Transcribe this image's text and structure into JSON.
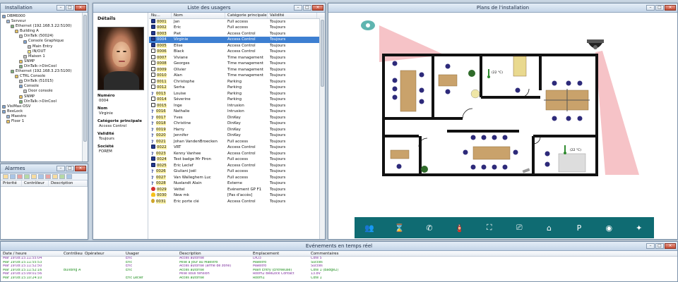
{
  "installation": {
    "title": "Installation",
    "tree": [
      {
        "label": "DBM6000",
        "depth": 0,
        "icon": "pc"
      },
      {
        "label": "Serveur",
        "depth": 1,
        "icon": "srv"
      },
      {
        "label": "Ethernet (192.168.3.22:5100)",
        "depth": 2,
        "icon": "net"
      },
      {
        "label": "Building A",
        "depth": 3,
        "icon": "fold"
      },
      {
        "label": "DinTalk (50024)",
        "depth": 4,
        "icon": "dev"
      },
      {
        "label": "Console Graphique",
        "depth": 5,
        "icon": "pc"
      },
      {
        "label": "Main Entry",
        "depth": 6,
        "icon": "dev"
      },
      {
        "label": "IN/OUT",
        "depth": 6,
        "icon": "key"
      },
      {
        "label": "Maison 1",
        "depth": 5,
        "icon": "dev"
      },
      {
        "label": "SNMP",
        "depth": 4,
        "icon": "fold"
      },
      {
        "label": "DinTalk->DinCool",
        "depth": 4,
        "icon": "net"
      },
      {
        "label": "Ethernet (192.168.3.23:5100)",
        "depth": 2,
        "icon": "net"
      },
      {
        "label": "CTRL Console",
        "depth": 3,
        "icon": "fold"
      },
      {
        "label": "DinTalk (51015)",
        "depth": 4,
        "icon": "dev"
      },
      {
        "label": "Console",
        "depth": 4,
        "icon": "pc"
      },
      {
        "label": "Door console",
        "depth": 5,
        "icon": "dev"
      },
      {
        "label": "SNMP",
        "depth": 4,
        "icon": "fold"
      },
      {
        "label": "DinTalk->DinCool",
        "depth": 4,
        "icon": "net"
      },
      {
        "label": "VisiMax-OSV",
        "depth": 0,
        "icon": "pc"
      },
      {
        "label": "BeeLock",
        "depth": 0,
        "icon": "pc"
      },
      {
        "label": "Maestro",
        "depth": 1,
        "icon": "srv"
      },
      {
        "label": "Floor 1",
        "depth": 1,
        "icon": "fold"
      }
    ]
  },
  "alarmes": {
    "title": "Alarmes",
    "columns": [
      "Priorité",
      "Contrôleur",
      "Description"
    ]
  },
  "users": {
    "title": "Liste des usagers",
    "details_title": "Détails",
    "details": [
      {
        "label": "Numéro",
        "value": "0004"
      },
      {
        "label": "Nom",
        "value": "Virginie"
      },
      {
        "label": "Catégorie principale",
        "value": "Access Control"
      },
      {
        "label": "Validité",
        "value": "Toujours"
      },
      {
        "label": "Société",
        "value": "FOREM"
      }
    ],
    "columns": [
      "Nu...",
      "Nom",
      "Catégorie principale",
      "Validité"
    ],
    "selected_index": 3,
    "rows": [
      {
        "icon": "badge",
        "num": "0001",
        "name": "Jan",
        "cat": "Full access",
        "val": "Toujours"
      },
      {
        "icon": "badge",
        "num": "0002",
        "name": "Eric",
        "cat": "Full access",
        "val": "Toujours"
      },
      {
        "icon": "badge",
        "num": "0003",
        "name": "Piet",
        "cat": "Access Control",
        "val": "Toujours"
      },
      {
        "icon": "badge",
        "num": "0004",
        "name": "Virginie",
        "cat": "Access Control",
        "val": "Toujours"
      },
      {
        "icon": "badge",
        "num": "0005",
        "name": "Elise",
        "cat": "Access Control",
        "val": "Toujours"
      },
      {
        "icon": "card",
        "num": "0006",
        "name": "Black",
        "cat": "Access Control",
        "val": "Toujours"
      },
      {
        "icon": "card",
        "num": "0007",
        "name": "Viviane",
        "cat": "Time management",
        "val": "Toujours"
      },
      {
        "icon": "card",
        "num": "0008",
        "name": "Georges",
        "cat": "Time management",
        "val": "Toujours"
      },
      {
        "icon": "card",
        "num": "0009",
        "name": "Olivier",
        "cat": "Time management",
        "val": "Toujours"
      },
      {
        "icon": "card",
        "num": "0010",
        "name": "Alan",
        "cat": "Time management",
        "val": "Toujours"
      },
      {
        "icon": "card",
        "num": "0011",
        "name": "Christophe",
        "cat": "Parking",
        "val": "Toujours"
      },
      {
        "icon": "card",
        "num": "0012",
        "name": "Serha",
        "cat": "Parking",
        "val": "Toujours"
      },
      {
        "icon": "q",
        "num": "0013",
        "name": "Louise",
        "cat": "Parking",
        "val": "Toujours"
      },
      {
        "icon": "card",
        "num": "0014",
        "name": "Séverine",
        "cat": "Parking",
        "val": "Toujours"
      },
      {
        "icon": "card",
        "num": "0015",
        "name": "Inge",
        "cat": "Intrusion",
        "val": "Toujours"
      },
      {
        "icon": "q",
        "num": "0016",
        "name": "Nathalie",
        "cat": "Intrusion",
        "val": "Toujours"
      },
      {
        "icon": "q",
        "num": "0017",
        "name": "Yves",
        "cat": "DinKey",
        "val": "Toujours"
      },
      {
        "icon": "q",
        "num": "0018",
        "name": "Christine",
        "cat": "DinKey",
        "val": "Toujours"
      },
      {
        "icon": "q",
        "num": "0019",
        "name": "Harry",
        "cat": "DinKey",
        "val": "Toujours"
      },
      {
        "icon": "q",
        "num": "0020",
        "name": "Jennifer",
        "cat": "DinKey",
        "val": "Toujours"
      },
      {
        "icon": "q",
        "num": "0021",
        "name": "Johan VandenBroecken",
        "cat": "Full access",
        "val": "Toujours"
      },
      {
        "icon": "badge",
        "num": "0022",
        "name": "VRT",
        "cat": "Access Control",
        "val": "Toujours"
      },
      {
        "icon": "q",
        "num": "0023",
        "name": "Kenny Vanhee",
        "cat": "Access Control",
        "val": "Toujours"
      },
      {
        "icon": "badge",
        "num": "0024",
        "name": "Test badge Mr Piron",
        "cat": "Full access",
        "val": "Toujours"
      },
      {
        "icon": "badge",
        "num": "0025",
        "name": "Eric Leclef",
        "cat": "Access Control",
        "val": "Toujours"
      },
      {
        "icon": "q",
        "num": "0026",
        "name": "Giuliani Joël",
        "cat": "Full access",
        "val": "Toujours"
      },
      {
        "icon": "q",
        "num": "0027",
        "name": "Van Walleghem Luc",
        "cat": "Full access",
        "val": "Toujours"
      },
      {
        "icon": "q",
        "num": "0028",
        "name": "Nuelandt Alain",
        "cat": "Externe",
        "val": "Toujours"
      },
      {
        "icon": "stop",
        "num": "0029",
        "name": "Vettel",
        "cat": "Evénement GP F1",
        "val": "Toujours"
      },
      {
        "icon": "bulb",
        "num": "0030",
        "name": "New mk",
        "cat": "[Pas d'accès]",
        "val": "Toujours"
      },
      {
        "icon": "key",
        "num": "0031",
        "name": "Eric porte clé",
        "cat": "Access Control",
        "val": "Toujours"
      }
    ]
  },
  "plan": {
    "title": "Plans de l'installation",
    "temp1": "(22 °C)",
    "temp2": "(22 °C)",
    "toolbar_icons": [
      "group-icon",
      "hourglass-icon",
      "phone-icon",
      "fire-extinguisher-icon",
      "stairs-icon",
      "camera-icon",
      "home-lock-icon",
      "parking-icon",
      "siren-icon",
      "scanner-icon"
    ]
  },
  "events": {
    "title": "Evénements en temps réel",
    "columns": [
      "Date / heure",
      "Contrôleur",
      "Opérateur",
      "Usager",
      "Description",
      "Emplacement",
      "Commentaires"
    ],
    "rows": [
      {
        "dt": "Mar 19:08:15:11:55:04",
        "ctrl": "",
        "op": "",
        "usr": "Eric",
        "desc": "Accès autorisé",
        "loc": "DIO3",
        "com": "Côté 5"
      },
      {
        "dt": "Mar 19:08:15:11:55:53",
        "ctrl": "",
        "op": "",
        "usr": "Eric",
        "desc": "Mise à jour au Maestro",
        "loc": "Maestro",
        "com": "Succès"
      },
      {
        "dt": "Mar 19:08:15:11:52:50",
        "ctrl": "",
        "op": "",
        "usr": "Eric",
        "desc": "Accès autorisé (armé de zone)",
        "loc": "Maestro",
        "com": "Succès"
      },
      {
        "dt": "Mar 19:08:15:11:52:16",
        "ctrl": "Building A",
        "op": "",
        "usr": "Eric",
        "desc": "Accès autorisé",
        "loc": "Main Entry (Entreeuse)",
        "com": "Côté 1 (Badge2)"
      },
      {
        "dt": "Mar 19:08:15:09:01:56",
        "ctrl": "",
        "op": "",
        "usr": "",
        "desc": "Mise sous tension",
        "loc": "Room2 BeeLock Contact",
        "com": "13.8V"
      },
      {
        "dt": "Mar 19:08:15:10:24:10",
        "ctrl": "",
        "op": "",
        "usr": "Eric Leclef",
        "desc": "Accès autorisé",
        "loc": "Room1",
        "com": "Côté 1"
      }
    ]
  }
}
